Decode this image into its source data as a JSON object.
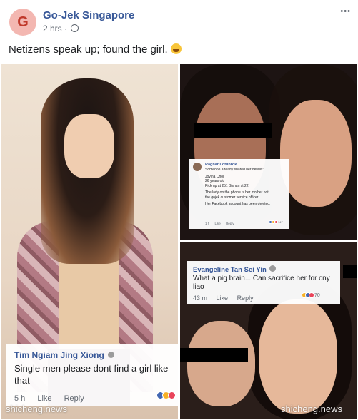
{
  "post": {
    "avatar_letter": "G",
    "page_name": "Go-Jek Singapore",
    "time": "2 hrs",
    "separator": "·",
    "more_glyph": "• • •",
    "caption": "Netizens speak up; found the girl."
  },
  "comments": {
    "left": {
      "name": "Tim Ngiam Jing Xiong",
      "text": "Single men please dont find a girl like that",
      "time": "5 h",
      "like": "Like",
      "reply": "Reply"
    },
    "right_top": {
      "name": "Ragnar Lothbrok",
      "lines": [
        "Someone already shared her details:",
        "",
        "Jovina Choi",
        "26 years old",
        "Pick up at 251 Bishan st 22",
        "",
        "The lady on the phone is her mother not",
        "the gojek customer service officer.",
        "",
        "Her Facebook account has been deleted."
      ],
      "time": "1 h",
      "like": "Like",
      "reply": "Reply",
      "reaction_count": "147"
    },
    "right_bottom": {
      "name": "Evangeline Tan Sei Yin",
      "text": "What a pig brain... Can sacrifice her for cny liao",
      "time": "43 m",
      "like": "Like",
      "reply": "Reply",
      "reaction_count": "70"
    }
  },
  "watermarks": [
    "shicheng.news",
    "shicheng.news"
  ],
  "colors": {
    "link_blue": "#385898",
    "avatar_bg": "#f3b7b1",
    "avatar_text": "#c0392b"
  }
}
